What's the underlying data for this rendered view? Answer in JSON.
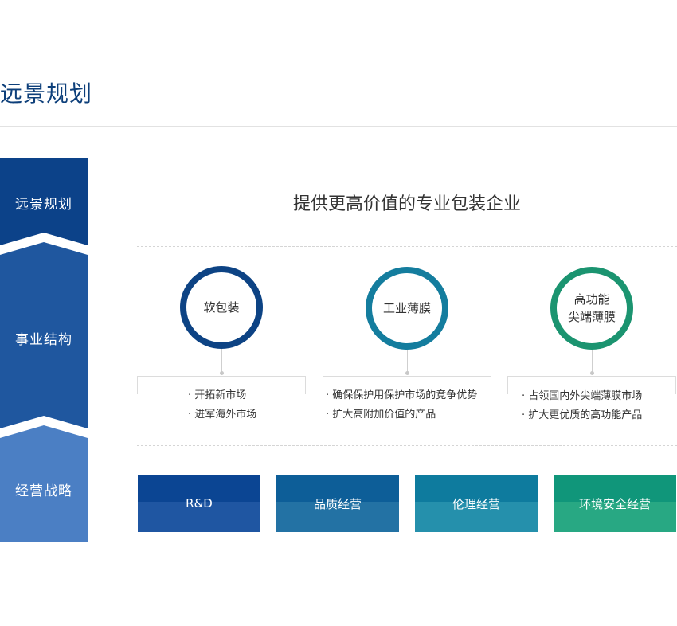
{
  "page_title": "远景规划",
  "strip": {
    "items": [
      {
        "label": "远景规划",
        "color": "#0c4289"
      },
      {
        "label": "事业结构",
        "color": "#1f579f"
      },
      {
        "label": "经营战略",
        "color": "#4b7fc4"
      }
    ]
  },
  "headline": "提供更高价值的专业包装企业",
  "pillars": [
    {
      "line1": "软包装",
      "line2": "",
      "ring_color": "#0d4384",
      "bullets": [
        "· 开拓新市场",
        "· 进军海外市场"
      ]
    },
    {
      "line1": "工业薄膜",
      "line2": "",
      "ring_color": "#147d9e",
      "bullets": [
        "· 确保保护用保护市场的竞争优势",
        "· 扩大高附加价值的产品"
      ]
    },
    {
      "line1": "高功能",
      "line2": "尖端薄膜",
      "ring_color": "#1b9470",
      "bullets": [
        "· 占领国内外尖端薄膜市场",
        "· 扩大更优质的高功能产品"
      ]
    }
  ],
  "strategies": [
    {
      "label": "R&D",
      "color_top": "#0b4593",
      "color_bottom": "#1f56a2"
    },
    {
      "label": "品质经营",
      "color_top": "#0d5e98",
      "color_bottom": "#2372a4"
    },
    {
      "label": "伦理经营",
      "color_top": "#0e7b9e",
      "color_bottom": "#2590ac"
    },
    {
      "label": "环境安全经营",
      "color_top": "#10967a",
      "color_bottom": "#28a883"
    }
  ]
}
